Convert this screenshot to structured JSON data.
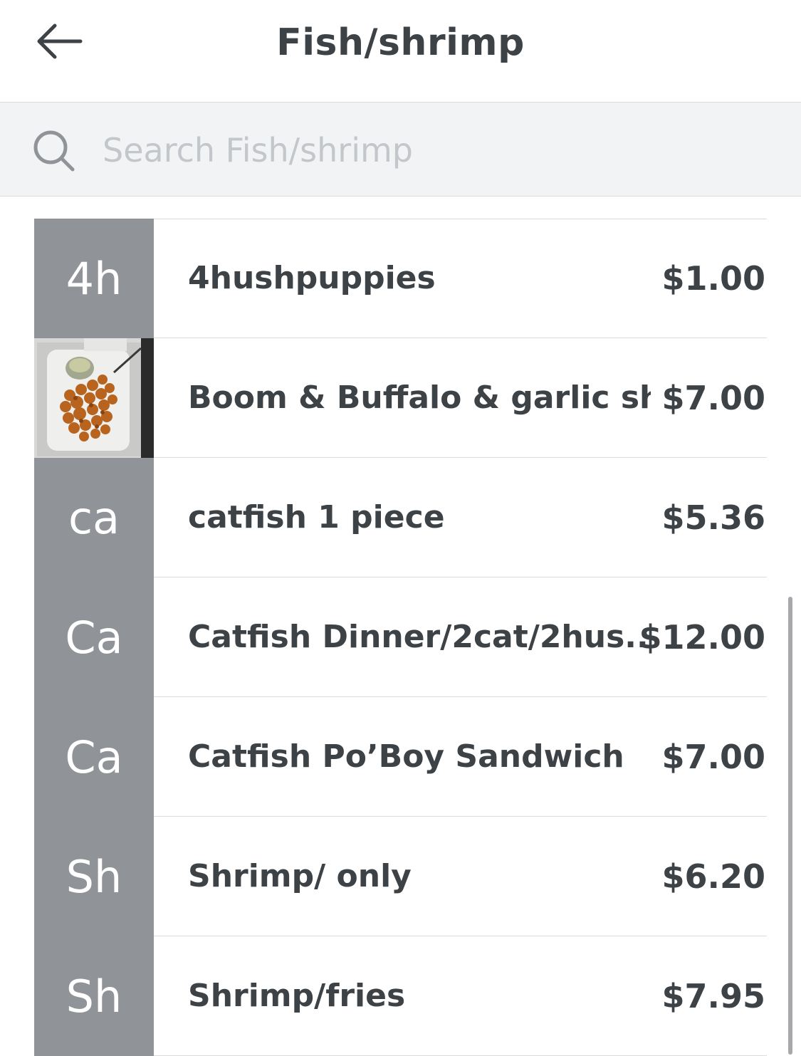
{
  "header": {
    "title": "Fish/shrimp",
    "back_icon": "arrow-left-icon"
  },
  "search": {
    "placeholder": "Search Fish/shrimp",
    "value": "",
    "icon": "search-icon"
  },
  "items": [
    {
      "initials": "4h",
      "name": "4hushpuppies",
      "price": "$1.00",
      "has_photo": false
    },
    {
      "initials": "",
      "name": "Boom & Buffalo & garlic sh...",
      "price": "$7.00",
      "has_photo": true
    },
    {
      "initials": "ca",
      "name": "catfish 1 piece",
      "price": "$5.36",
      "has_photo": false
    },
    {
      "initials": "Ca",
      "name": "Catfish Dinner/2cat/2hus...",
      "price": "$12.00",
      "has_photo": false
    },
    {
      "initials": "Ca",
      "name": "Catfish Po’Boy Sandwich",
      "price": "$7.00",
      "has_photo": false
    },
    {
      "initials": "Sh",
      "name": "Shrimp/ only",
      "price": "$6.20",
      "has_photo": false
    },
    {
      "initials": "Sh",
      "name": "Shrimp/fries",
      "price": "$7.95",
      "has_photo": false
    }
  ],
  "colors": {
    "thumb_bg": "#909398",
    "text": "#3d4247",
    "divider": "#d9dbdd",
    "search_bg": "#f2f3f4"
  }
}
